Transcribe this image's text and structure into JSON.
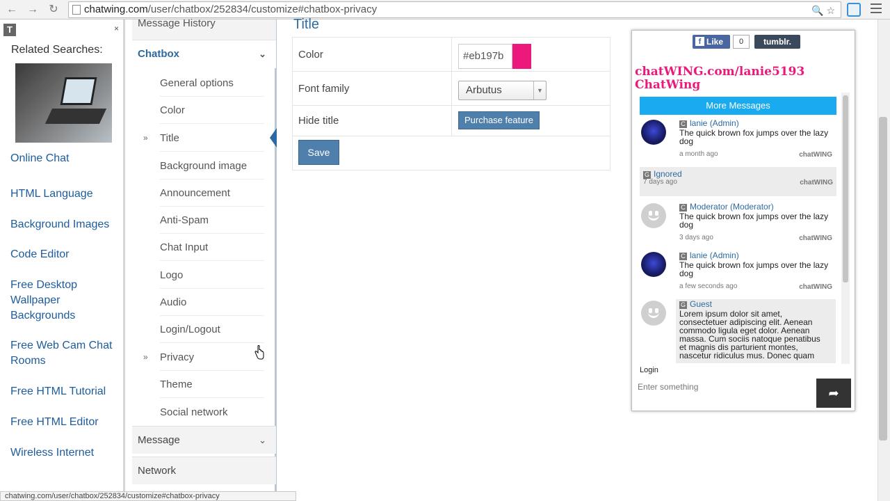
{
  "browser": {
    "url_domain": "chatwing.com",
    "url_path": "/user/chatbox/252834/customize#chatbox-privacy"
  },
  "left_pane": {
    "related_title": "Related Searches:",
    "links": [
      {
        "lines": [
          "Online Chat"
        ]
      },
      {
        "lines": [
          "HTML Language"
        ]
      },
      {
        "lines": [
          "Background Images"
        ]
      },
      {
        "lines": [
          "Code Editor"
        ]
      },
      {
        "lines": [
          "Free Desktop",
          "Wallpaper",
          "Backgrounds"
        ]
      },
      {
        "lines": [
          "Free Web Cam Chat",
          "Rooms"
        ]
      },
      {
        "lines": [
          "Free HTML Tutorial"
        ]
      },
      {
        "lines": [
          "Free HTML Editor"
        ]
      },
      {
        "lines": [
          "Wireless Internet"
        ]
      }
    ]
  },
  "side_menu": {
    "top_item": "Message History",
    "chatbox_header": "Chatbox",
    "items": [
      "General options",
      "Color",
      "Title",
      "Background image",
      "Announcement",
      "Anti-Spam",
      "Chat Input",
      "Logo",
      "Audio",
      "Login/Logout",
      "Privacy",
      "Theme",
      "Social network"
    ],
    "message_header": "Message",
    "network_header": "Network"
  },
  "main": {
    "section_title": "Title",
    "rows": {
      "color_label": "Color",
      "color_value": "#eb197b",
      "font_label": "Font family",
      "font_value": "Arbutus",
      "hide_label": "Hide title",
      "purchase_label": "Purchase feature"
    },
    "save_label": "Save"
  },
  "chatbox": {
    "like_label": "Like",
    "like_count": "0",
    "tumblr_label": "tumblr.",
    "title_line1": "chatWING.com/lanie5193",
    "title_line2": "ChatWing",
    "title_color": "#eb197b",
    "more_messages": "More Messages",
    "messages": [
      {
        "badge": "C",
        "name": "lanie (Admin)",
        "text_lines": [
          "The quick brown fox jumps over the lazy",
          "dog"
        ],
        "time": "a month ago",
        "brand": "chatWING"
      },
      {
        "badge": "G",
        "name": "Ignored",
        "text_lines": [],
        "time": "7 days ago",
        "brand": "chatWING"
      },
      {
        "badge": "C",
        "name": "Moderator (Moderator)",
        "text_lines": [
          "The quick brown fox jumps over the lazy",
          "dog"
        ],
        "time": "3 days ago",
        "brand": "chatWING"
      },
      {
        "badge": "C",
        "name": "lanie (Admin)",
        "text_lines": [
          "The quick brown fox jumps over the lazy",
          "dog"
        ],
        "time": "a few seconds ago",
        "brand": "chatWING"
      },
      {
        "badge": "G",
        "name": "Guest",
        "text_lines": [
          "Lorem ipsum dolor sit amet,",
          "consectetuer adipiscing elit. Aenean",
          "commodo ligula eget dolor. Aenean",
          "massa. Cum sociis natoque penatibus",
          "et magnis dis parturient montes,",
          "nascetur ridiculus mus. Donec quam"
        ],
        "time": "",
        "brand": ""
      }
    ],
    "login_label": "Login",
    "input_placeholder": "Enter something",
    "accent_color": "#19aaf0"
  },
  "status_bar": "chatwing.com/user/chatbox/252834/customize#chatbox-privacy",
  "icons": [
    "back-icon",
    "forward-icon",
    "reload-icon",
    "page-icon",
    "zoom-icon",
    "star-icon",
    "extension-icon",
    "menu-icon",
    "send-icon"
  ]
}
